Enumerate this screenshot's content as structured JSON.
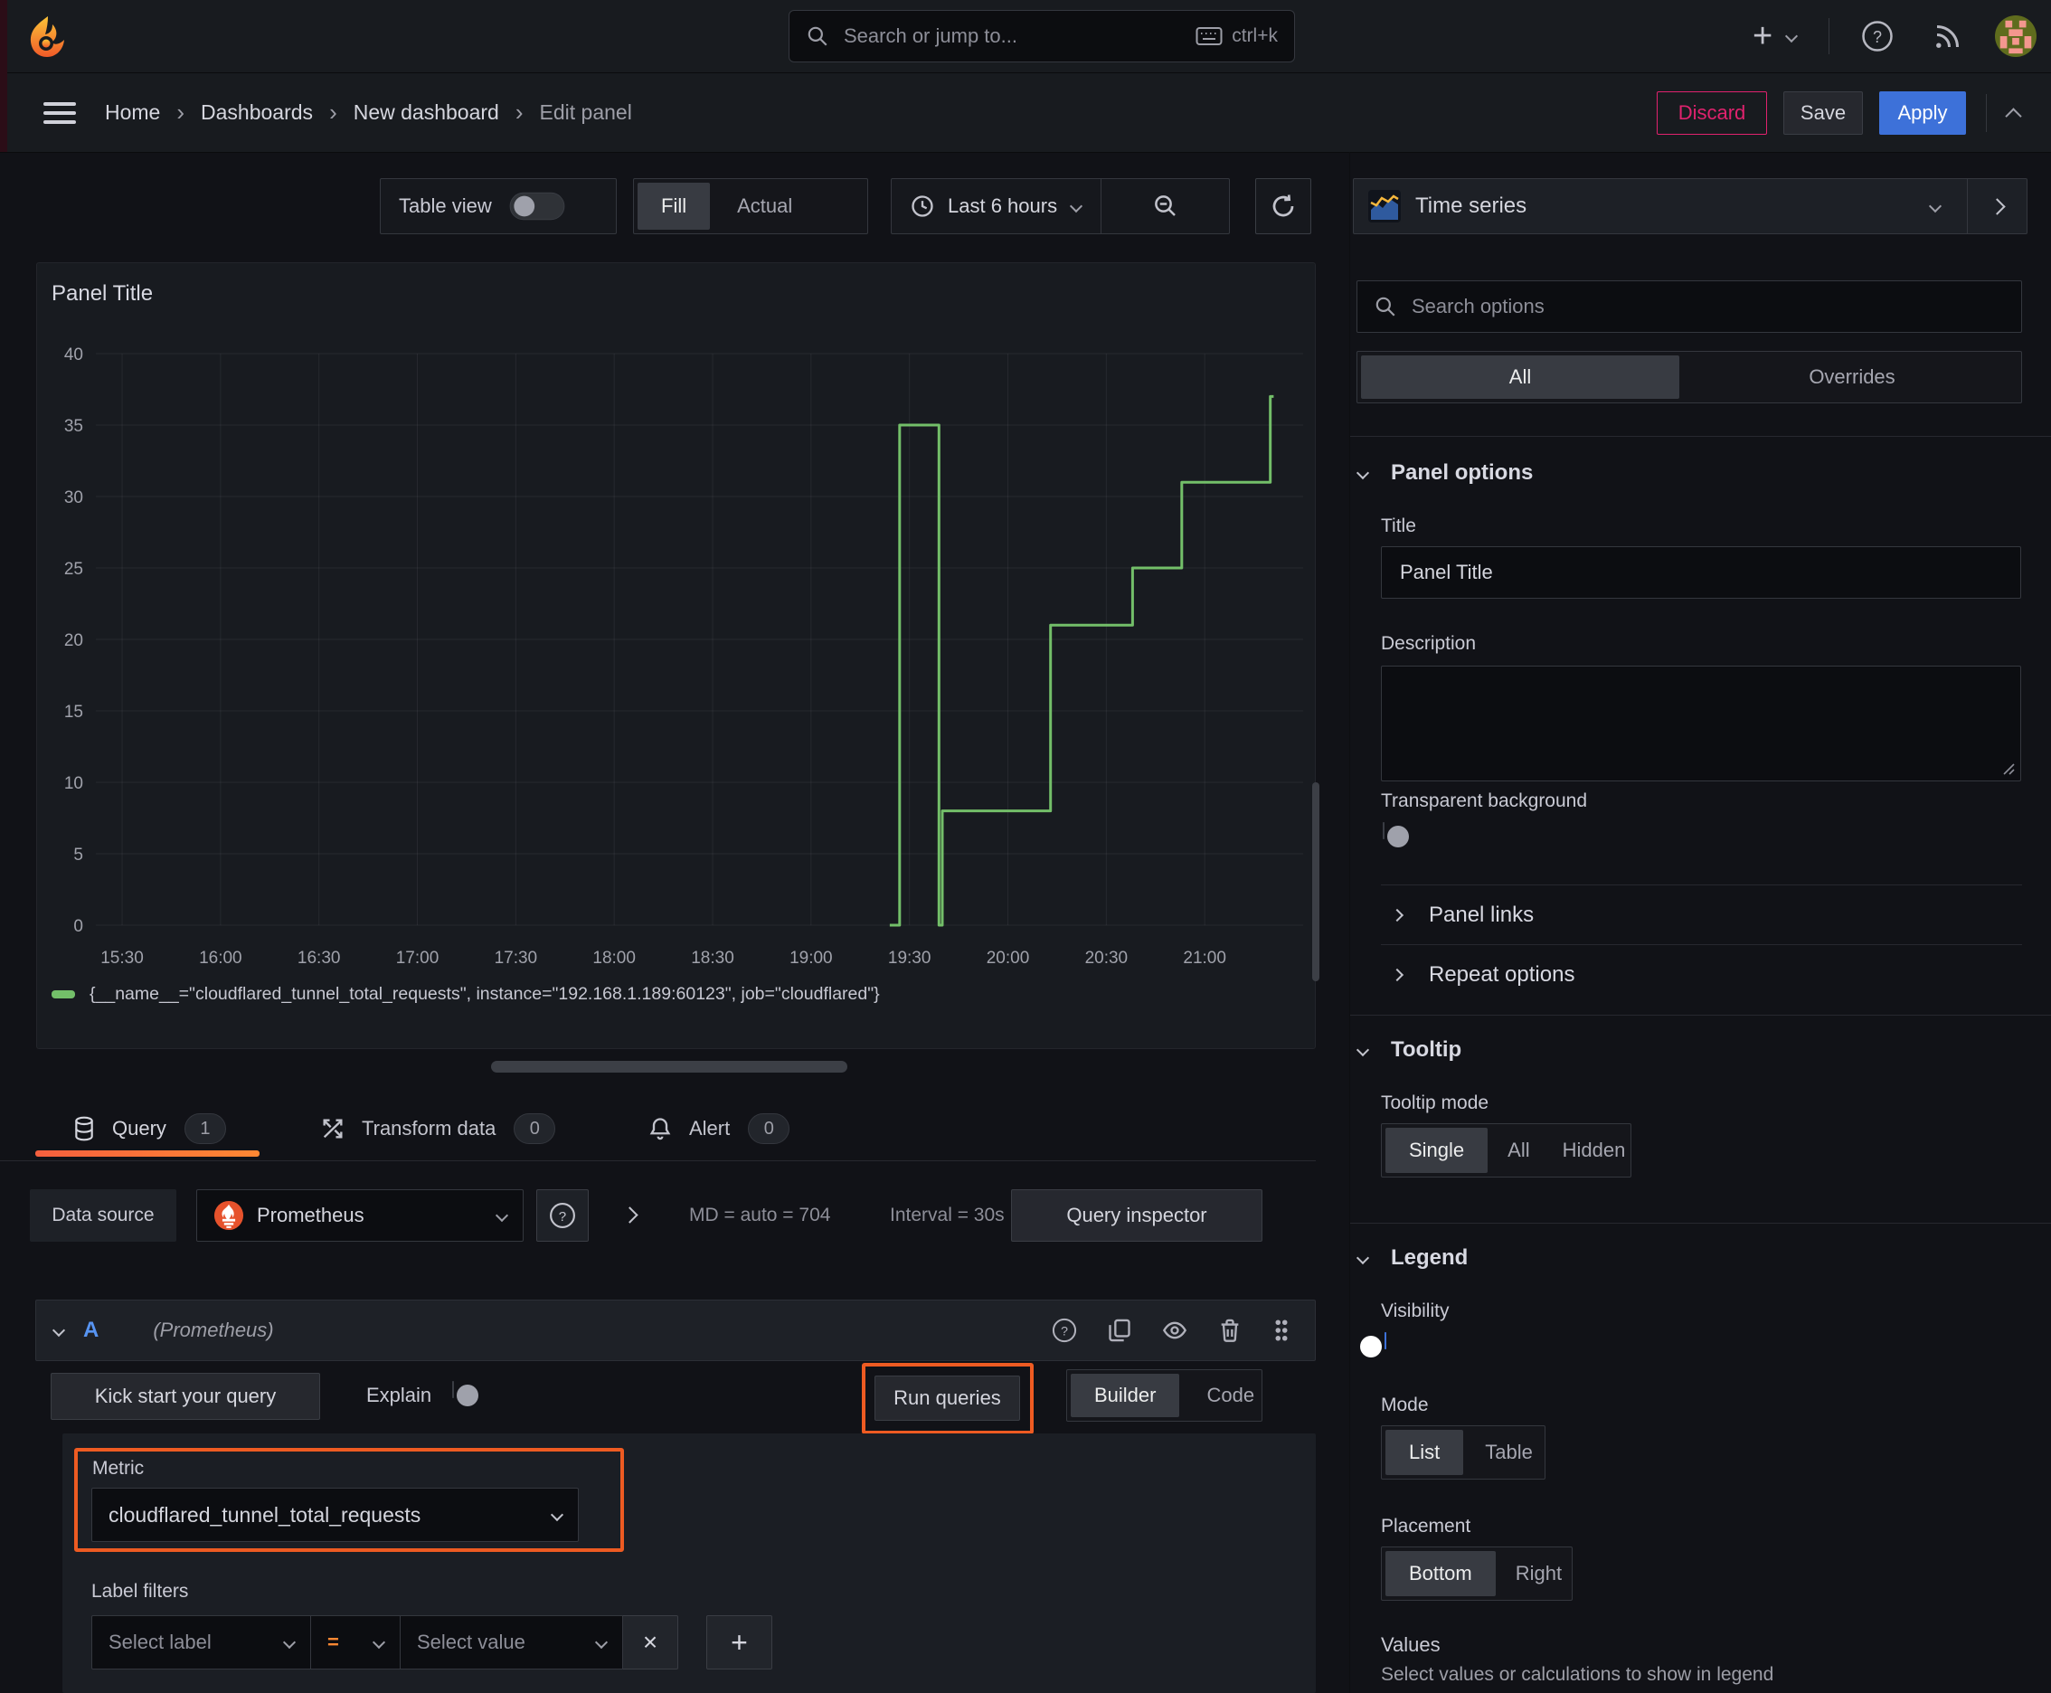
{
  "nav": {
    "search_placeholder": "Search or jump to...",
    "search_shortcut": "ctrl+k"
  },
  "breadcrumb": {
    "items": [
      "Home",
      "Dashboards",
      "New dashboard",
      "Edit panel"
    ]
  },
  "actions": {
    "discard": "Discard",
    "save": "Save",
    "apply": "Apply"
  },
  "toolbar": {
    "table_view": "Table view",
    "fill": "Fill",
    "actual": "Actual",
    "display_selected": "Fill",
    "time_range": "Last 6 hours"
  },
  "viz_picker": {
    "label": "Time series"
  },
  "panel": {
    "title": "Panel Title"
  },
  "chart_data": {
    "type": "line",
    "line_interpolation": "step-after",
    "title": "Panel Title",
    "series": [
      {
        "name": "{__name__=\"cloudflared_tunnel_total_requests\", instance=\"192.168.1.189:60123\", job=\"cloudflared\"}",
        "color": "#73bf69"
      }
    ],
    "series_name": "{__name__=\"cloudflared_tunnel_total_requests\", instance=\"192.168.1.189:60123\", job=\"cloudflared\"}",
    "x_ticks": [
      "15:30",
      "16:00",
      "16:30",
      "17:00",
      "17:30",
      "18:00",
      "18:30",
      "19:00",
      "19:30",
      "20:00",
      "20:30",
      "21:00"
    ],
    "y_ticks": [
      0,
      5,
      10,
      15,
      20,
      25,
      30,
      35,
      40
    ],
    "ylim": [
      0,
      40
    ],
    "x_range": [
      "15:22",
      "21:30"
    ],
    "legend_position": "bottom",
    "grid": true,
    "points": [
      [
        "19:24",
        0
      ],
      [
        "19:27",
        0
      ],
      [
        "19:27",
        35
      ],
      [
        "19:39",
        35
      ],
      [
        "19:39",
        0
      ],
      [
        "19:40",
        0
      ],
      [
        "19:40",
        8
      ],
      [
        "20:13",
        8
      ],
      [
        "20:13",
        21
      ],
      [
        "20:38",
        21
      ],
      [
        "20:38",
        25
      ],
      [
        "20:53",
        25
      ],
      [
        "20:53",
        31
      ],
      [
        "21:20",
        31
      ],
      [
        "21:20",
        37
      ],
      [
        "21:21",
        37
      ]
    ]
  },
  "tabs": {
    "query": {
      "label": "Query",
      "count": "1"
    },
    "transform": {
      "label": "Transform data",
      "count": "0"
    },
    "alert": {
      "label": "Alert",
      "count": "0"
    },
    "active": "Query"
  },
  "datasource_row": {
    "label": "Data source",
    "name": "Prometheus",
    "stats_md": "MD = auto = 704",
    "stats_interval": "Interval = 30s",
    "inspector": "Query inspector"
  },
  "query_editor": {
    "ref_id": "A",
    "ds_hint": "(Prometheus)",
    "kick_start": "Kick start your query",
    "explain": "Explain",
    "run_queries": "Run queries",
    "builder": "Builder",
    "code": "Code",
    "editor_mode_selected": "Builder",
    "metric_label": "Metric",
    "metric_value": "cloudflared_tunnel_total_requests",
    "label_filters_label": "Label filters",
    "select_label_placeholder": "Select label",
    "operator": "=",
    "select_value_placeholder": "Select value"
  },
  "options": {
    "search_placeholder": "Search options",
    "tabs": {
      "all": "All",
      "overrides": "Overrides",
      "selected": "All"
    },
    "panel_options": {
      "title": "Panel options",
      "title_label": "Title",
      "title_value": "Panel Title",
      "description_label": "Description",
      "transparent_label": "Transparent background",
      "panel_links": "Panel links",
      "repeat_options": "Repeat options"
    },
    "tooltip": {
      "title": "Tooltip",
      "mode_label": "Tooltip mode",
      "modes": [
        "Single",
        "All",
        "Hidden"
      ],
      "mode_selected": "Single"
    },
    "legend": {
      "title": "Legend",
      "visibility_label": "Visibility",
      "visibility_on": true,
      "mode_label": "Mode",
      "modes": [
        "List",
        "Table"
      ],
      "mode_selected": "List",
      "placement_label": "Placement",
      "placements": [
        "Bottom",
        "Right"
      ],
      "placement_selected": "Bottom",
      "values_label": "Values",
      "values_hint": "Select values or calculations to show in legend"
    }
  },
  "colors": {
    "series_green": "#73bf69",
    "accent_blue": "#3d71d9",
    "danger_pink": "#e0226e",
    "highlight_orange": "#ee5b22",
    "tab_underline_from": "#f55f3e",
    "tab_underline_to": "#ff8833"
  }
}
